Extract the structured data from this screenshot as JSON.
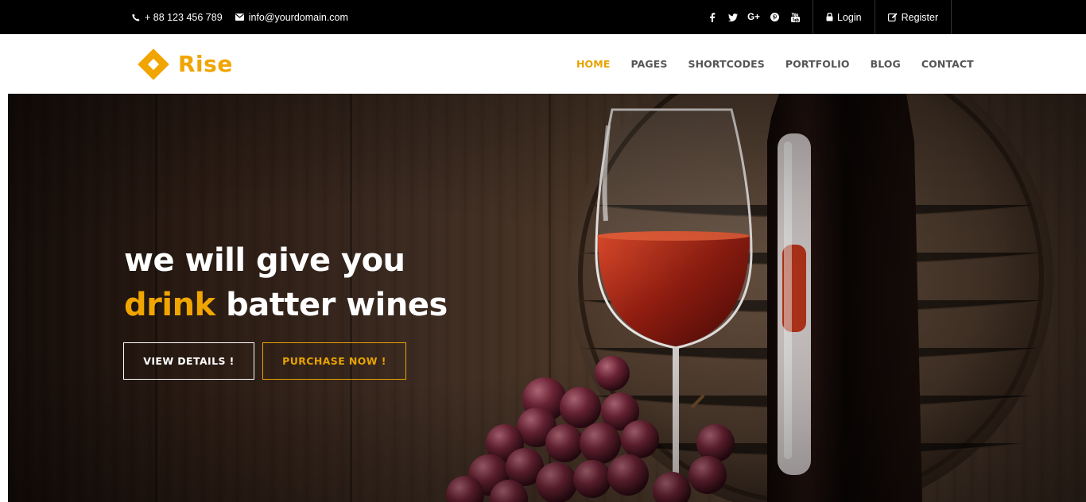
{
  "topbar": {
    "phone": "+ 88 123 456 789",
    "email": "info@yourdomain.com",
    "social": [
      "facebook-icon",
      "twitter-icon",
      "google-plus-icon",
      "pinterest-icon",
      "youtube-icon"
    ],
    "social_glyphs": [
      "f",
      "t",
      "G+",
      "p",
      "yt"
    ],
    "login": "Login",
    "register": "Register"
  },
  "nav": {
    "logo_text": "Rise",
    "items": [
      {
        "label": "HOME",
        "active": true
      },
      {
        "label": "PAGES",
        "active": false
      },
      {
        "label": "SHORTCODES",
        "active": false
      },
      {
        "label": "PORTFOLIO",
        "active": false
      },
      {
        "label": "BLOG",
        "active": false
      },
      {
        "label": "CONTACT",
        "active": false
      }
    ]
  },
  "hero": {
    "line1": "we will give you",
    "line2_accent": "drink",
    "line2_rest": " batter wines",
    "btn_details": "VIEW DETAILS !",
    "btn_purchase": "PURCHASE NOW !"
  },
  "colors": {
    "accent": "#f0a500",
    "topbar": "#000000",
    "nav_text": "#555555"
  }
}
